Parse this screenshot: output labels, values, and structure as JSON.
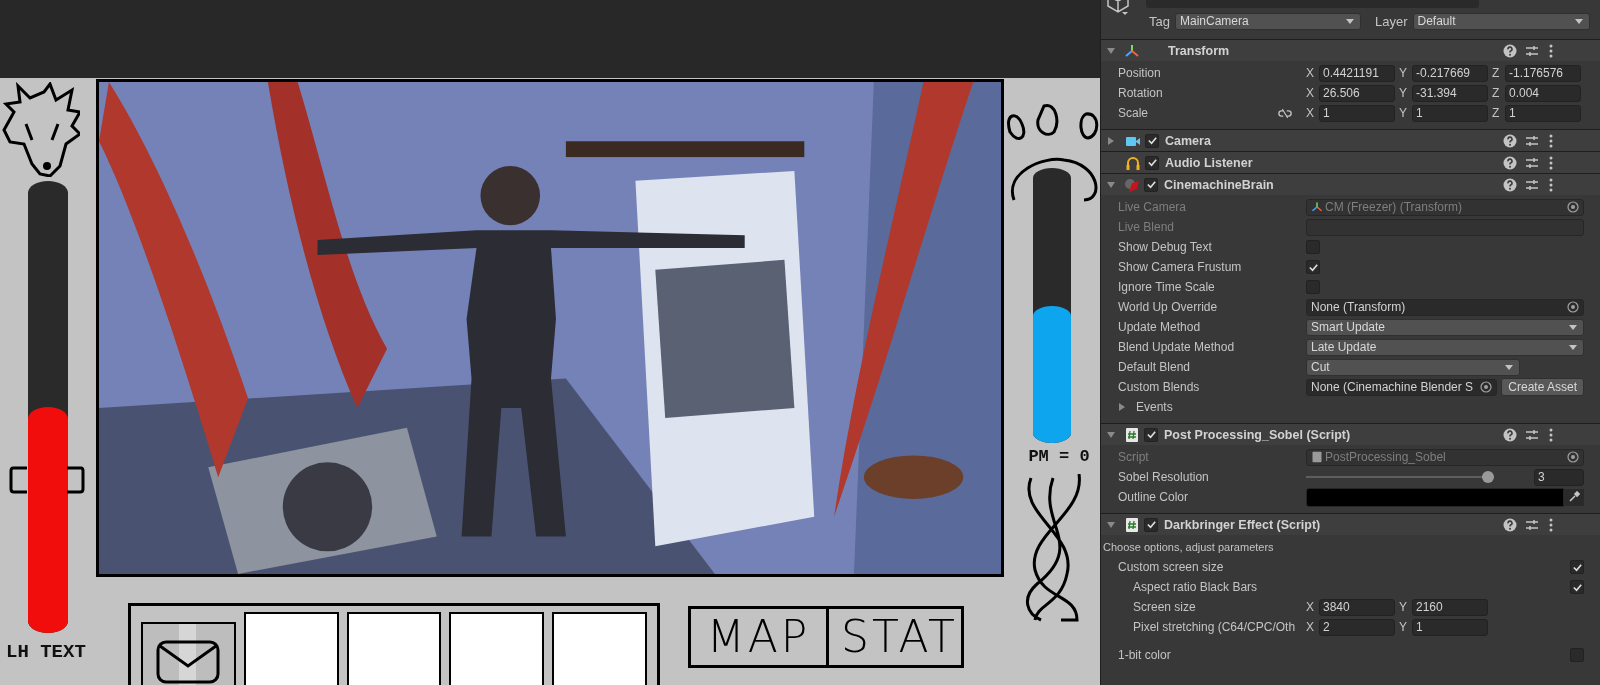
{
  "game": {
    "view": {
      "kind": "picture"
    },
    "left_meter": {
      "level": 0.5,
      "label": "LH TEXT"
    },
    "right_meter": {
      "level": 0.5,
      "label": "PM = 0"
    },
    "slots": [
      {
        "kind": "mail"
      },
      {
        "kind": "empty"
      },
      {
        "kind": "empty"
      },
      {
        "kind": "empty"
      },
      {
        "kind": "empty"
      }
    ],
    "buttons": [
      "MAP",
      "STAT"
    ]
  },
  "inspector": {
    "tag": {
      "label": "Tag",
      "value": "MainCamera"
    },
    "layer": {
      "label": "Layer",
      "value": "Default"
    },
    "components": [
      {
        "title": "Transform",
        "expanded": true,
        "rows": [
          {
            "kind": "vector",
            "label": "Position",
            "disabled": false,
            "fields": [
              {
                "axis": "X",
                "value": "0.4421191"
              },
              {
                "axis": "Y",
                "value": "-0.217669"
              },
              {
                "axis": "Z",
                "value": "-1.176576"
              }
            ]
          },
          {
            "kind": "vector",
            "label": "Rotation",
            "disabled": false,
            "fields": [
              {
                "axis": "X",
                "value": "26.506"
              },
              {
                "axis": "Y",
                "value": "-31.394"
              },
              {
                "axis": "Z",
                "value": "0.004"
              }
            ]
          },
          {
            "kind": "vector",
            "label": "Scale",
            "disabled": false,
            "linked": false,
            "fields": [
              {
                "axis": "X",
                "value": "1"
              },
              {
                "axis": "Y",
                "value": "1"
              },
              {
                "axis": "Z",
                "value": "1"
              }
            ]
          }
        ]
      },
      {
        "title": "Camera",
        "expanded": false,
        "enabled": true
      },
      {
        "title": "Audio Listener",
        "enabled": true
      },
      {
        "title": "CinemachineBrain",
        "expanded": true,
        "enabled": true,
        "rows": [
          {
            "kind": "object",
            "label": "Live Camera",
            "value": "CM (Freezer) (Transform)",
            "disabled": true
          },
          {
            "kind": "text",
            "label": "Live Blend",
            "disabled": true
          },
          {
            "kind": "checkbox",
            "label": "Show Debug Text",
            "checked": false,
            "disabled": false
          },
          {
            "kind": "checkbox",
            "label": "Show Camera Frustum",
            "checked": true,
            "disabled": false
          },
          {
            "kind": "checkbox",
            "label": "Ignore Time Scale",
            "checked": false,
            "disabled": false
          },
          {
            "kind": "object",
            "label": "World Up Override",
            "value": "None (Transform)",
            "disabled": false
          },
          {
            "kind": "dropdown",
            "label": "Update Method",
            "value": "Smart Update",
            "short": false,
            "disabled": false
          },
          {
            "kind": "dropdown",
            "label": "Blend Update Method",
            "value": "Late Update",
            "short": false,
            "disabled": false
          },
          {
            "kind": "dropdown",
            "label": "Default Blend",
            "value": "Cut",
            "short": true,
            "disabled": false
          },
          {
            "kind": "object_button",
            "label": "Custom Blends",
            "value": "None (Cinemachine Blender S",
            "button": "Create Asset",
            "disabled": false
          },
          {
            "kind": "foldout",
            "label": "Events",
            "expanded": false,
            "disabled": false
          }
        ]
      },
      {
        "title": "Post Processing_Sobel (Script)",
        "expanded": true,
        "enabled": true,
        "rows": [
          {
            "kind": "object",
            "label": "Script",
            "value": "PostProcessing_Sobel",
            "disabled": true
          },
          {
            "kind": "slider",
            "label": "Sobel Resolution",
            "level": 1,
            "value": "3",
            "disabled": false
          },
          {
            "kind": "color",
            "label": "Outline Color",
            "color": "#000000",
            "disabled": false
          }
        ]
      },
      {
        "title": "Darkbringer Effect (Script)",
        "expanded": true,
        "enabled": true,
        "rows": [
          {
            "kind": "note",
            "label": "Choose options, adjust parameters",
            "disabled": false
          },
          {
            "kind": "toggle",
            "label": "Custom screen size",
            "checked": true,
            "disabled": false,
            "children": [
              {
                "kind": "toggle",
                "label": "Aspect ratio Black Bars",
                "checked": true,
                "disabled": false
              },
              {
                "kind": "vector",
                "label": "Screen size",
                "disabled": false,
                "fields": [
                  {
                    "axis": "X",
                    "value": "3840"
                  },
                  {
                    "axis": "Y",
                    "value": "2160"
                  }
                ]
              },
              {
                "kind": "vector",
                "label": "Pixel stretching (C64/CPC/Oth",
                "disabled": false,
                "fields": [
                  {
                    "axis": "X",
                    "value": "2"
                  },
                  {
                    "axis": "Y",
                    "value": "1"
                  }
                ]
              }
            ]
          },
          {
            "kind": "toggle",
            "label": "1-bit color",
            "checked": false,
            "disabled": false
          }
        ]
      }
    ]
  }
}
